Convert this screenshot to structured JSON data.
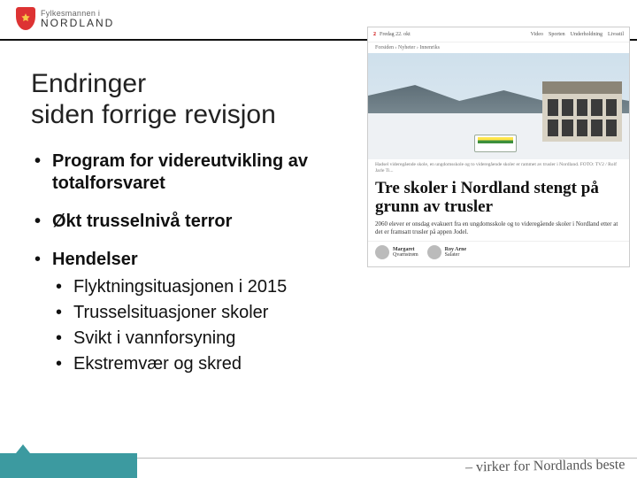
{
  "header": {
    "brand_top": "Fylkesmannen i",
    "brand_name": "NORDLAND"
  },
  "title_line1": "Endringer",
  "title_line2": "siden forrige revisjon",
  "bullets": {
    "b1": "Program for videreutvikling av totalforsvaret",
    "b2": "Økt trusselnivå terror",
    "b3": "Hendelser",
    "sub": {
      "s1": "Flyktningsituasjonen i 2015",
      "s2": "Trusselsituasjoner skoler",
      "s3": "Svikt i vannforsyning",
      "s4": "Ekstremvær og skred"
    }
  },
  "news": {
    "site_id": "2",
    "site_date": "Fredag 22. okt",
    "nav": {
      "n1": "Video",
      "n2": "Sporten",
      "n3": "Underholdning",
      "n4": "Livsstil"
    },
    "breadcrumb": "Forsiden  ›  Nyheter  ›  Innenriks",
    "caption": "Hadsel videregående skole, en ungdomsskole og to videregående skoler er rammet av trusler i Nordland. FOTO: TV2 / Rolf Jarle Ti...",
    "headline": "Tre skoler i Nordland stengt på grunn av trusler",
    "lede": "2060 elever er onsdag evakuert fra en ungdomsskole og to videregående skoler i Nordland etter at det er framsatt trusler på appen Jodel.",
    "byline1_name": "Margaret",
    "byline1_role": "Qvarnstrøm",
    "byline2_name": "Roy Arne",
    "byline2_role": "Salater"
  },
  "footer": {
    "motto": "– virker for Nordlands beste"
  }
}
